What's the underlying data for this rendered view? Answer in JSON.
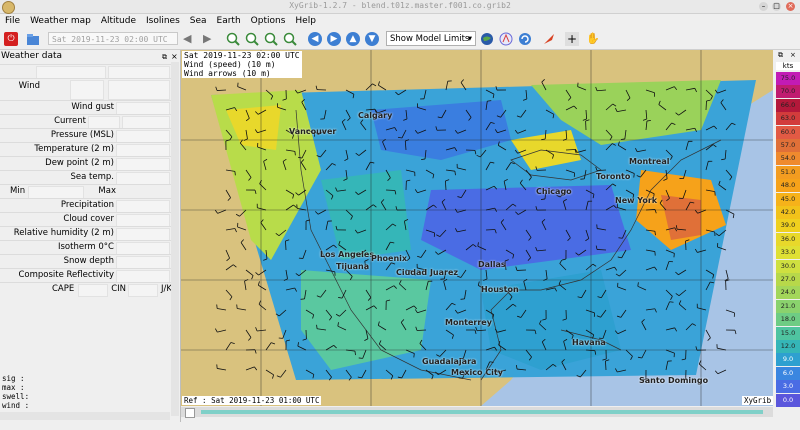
{
  "window": {
    "title": "XyGrib-1.2.7 - blend.t01z.master.f001.co.grib2"
  },
  "menu": [
    "File",
    "Weather map",
    "Altitude",
    "Isolines",
    "Sea",
    "Earth",
    "Options",
    "Help"
  ],
  "toolbar": {
    "date_value": "Sat 2019-11-23 02:00 UTC",
    "model_combo": "Show Model Limits"
  },
  "panel": {
    "title": "Weather data",
    "rows": {
      "wind": "Wind",
      "wind_gust": "Wind gust",
      "current": "Current",
      "pressure": "Pressure (MSL)",
      "temperature": "Temperature (2 m)",
      "dew_point": "Dew point (2 m)",
      "sea_temp": "Sea temp.",
      "min": "Min",
      "max": "Max",
      "precipitation": "Precipitation",
      "cloud_cover": "Cloud cover",
      "humidity": "Relative humidity (2 m)",
      "isotherm": "Isotherm 0°C",
      "snow_depth": "Snow depth",
      "reflectivity": "Composite Reflectivity",
      "cape": "CAPE",
      "cin": "CIN",
      "jk": "J/K"
    },
    "sea_lines": [
      "sig  :",
      "max  :",
      "swell:",
      "wind :"
    ]
  },
  "map": {
    "header_date": "Sat 2019-11-23 02:00 UTC",
    "header_wind": "Wind (speed) (10 m)",
    "header_arrows": "Wind arrows (10 m)",
    "ref": "Ref : Sat 2019-11-23 01:00 UTC",
    "brand": "XyGrib",
    "cities": [
      "Calgary",
      "Vancouver",
      "Montreal",
      "Toronto",
      "Chicago",
      "New York",
      "Los Angeles",
      "Phoenix",
      "Tijuana",
      "Ciudad Juarez",
      "Dallas",
      "Houston",
      "Monterrey",
      "Havana",
      "Guadalajara",
      "Mexico City",
      "Santo Domingo"
    ]
  },
  "legend": {
    "unit": "kts",
    "values": [
      "75.0",
      "70.0",
      "66.0",
      "63.0",
      "60.0",
      "57.0",
      "54.0",
      "51.0",
      "48.0",
      "45.0",
      "42.0",
      "39.0",
      "36.0",
      "33.0",
      "30.0",
      "27.0",
      "24.0",
      "21.0",
      "18.0",
      "15.0",
      "12.0",
      "9.0",
      "6.0",
      "3.0",
      "0.0"
    ],
    "colors": [
      "#c21bb5",
      "#c01c70",
      "#b3183a",
      "#d23c3c",
      "#e25a44",
      "#e07038",
      "#ef8a2e",
      "#f39c20",
      "#f6a21a",
      "#f6b21a",
      "#f2c21a",
      "#efd01e",
      "#e8d82b",
      "#dfe034",
      "#cfe040",
      "#b7d84a",
      "#a3d65a",
      "#8ad26d",
      "#6ecc84",
      "#4fc4a0",
      "#35b6b8",
      "#2ea0d0",
      "#3a86e0",
      "#4a6ce4",
      "#5a56dc"
    ]
  }
}
